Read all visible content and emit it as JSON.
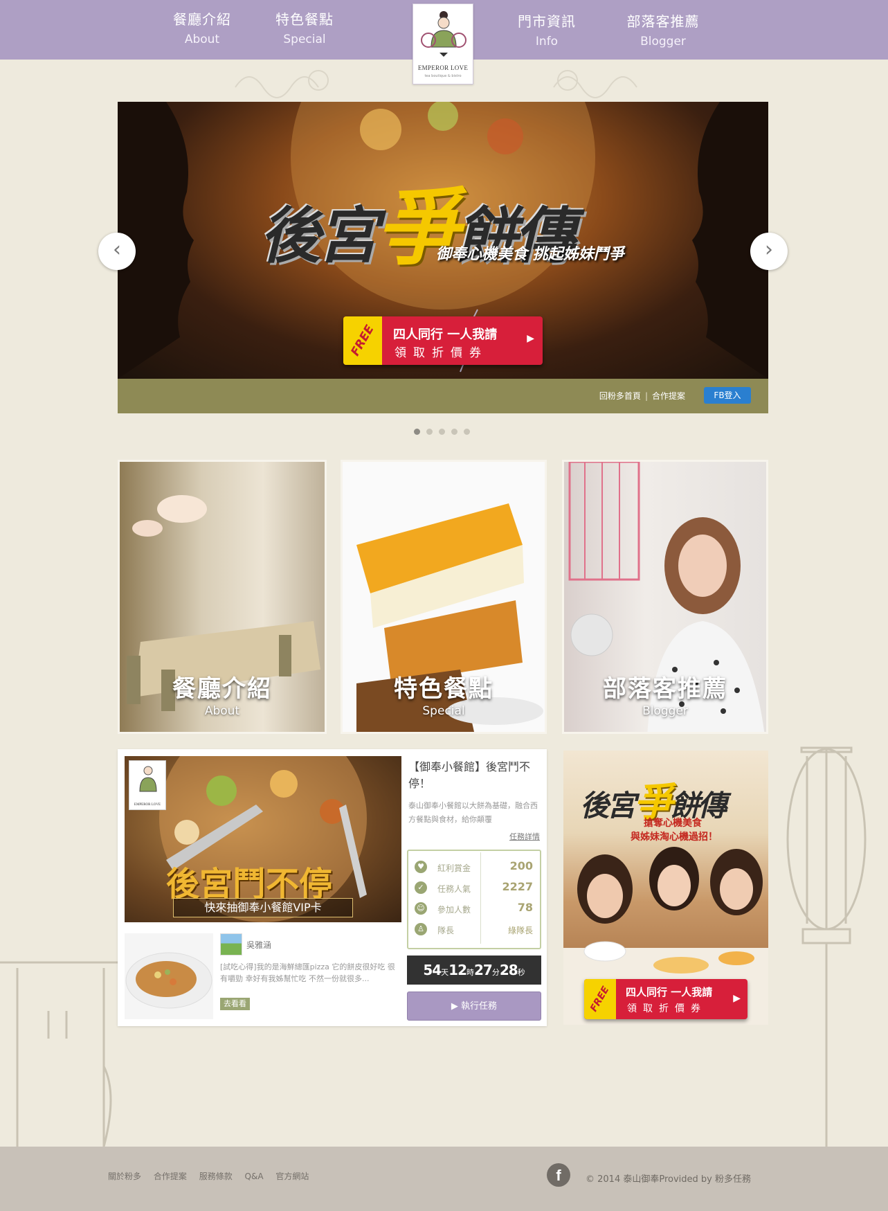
{
  "nav": {
    "about": {
      "zh": "餐廳介紹",
      "en": "About"
    },
    "special": {
      "zh": "特色餐點",
      "en": "Special"
    },
    "info": {
      "zh": "門市資訊",
      "en": "Info"
    },
    "blogger": {
      "zh": "部落客推薦",
      "en": "Blogger"
    }
  },
  "logo": {
    "name": "EMPEROR LOVE",
    "tagline": "tea boutique & bistro"
  },
  "hero": {
    "title_a": "後宮",
    "title_accent": "爭",
    "title_b": "餅傳",
    "subtitle": "御奉心機美食 挑起姊妹鬥爭",
    "cta_free": "FREE",
    "cta_line1": "四人同行 一人我請",
    "cta_line2": "領取折價券",
    "links": [
      "回粉多首頁",
      "合作提案"
    ],
    "fb_login": "FB登入",
    "slides": 5,
    "active_slide": 1
  },
  "cards": [
    {
      "title": "餐廳介紹",
      "subtitle": "About"
    },
    {
      "title": "特色餐點",
      "subtitle": "Special"
    },
    {
      "title": "部落客推薦",
      "subtitle": "Blogger"
    }
  ],
  "mission": {
    "image_title": "後宮鬥不停",
    "image_subtitle": "快來抽御奉小餐館VIP卡",
    "image_logo": "EMPEROR LOVE",
    "title": "【御奉小餐館】後宮鬥不停！",
    "description": "泰山御奉小餐館以大餅為基礎，融合西方餐點與食材，給你顛覆",
    "detail_link": "任務詳情",
    "stats": [
      {
        "icon": "heart-icon",
        "label": "紅利賞金",
        "value": "200"
      },
      {
        "icon": "thumbs-up-icon",
        "label": "任務人氣",
        "value": "2227"
      },
      {
        "icon": "smiley-icon",
        "label": "參加人數",
        "value": "78"
      },
      {
        "icon": "person-icon",
        "label": "隊長",
        "value": "綠隊長"
      }
    ],
    "countdown": {
      "days": "54",
      "days_unit": "天",
      "hours": "12",
      "hours_unit": "時",
      "minutes": "27",
      "minutes_unit": "分",
      "seconds": "28",
      "seconds_unit": "秒"
    },
    "exec_button": "▶ 執行任務",
    "review": {
      "name": "吳雅涵",
      "text": "[試吃心得]我的是海鮮總匯pizza  它的餅皮很好吃 很有嚼勁 幸好有我姊幫忙吃 不然一份就很多...",
      "button": "去看看"
    }
  },
  "promo": {
    "title_a": "後宮",
    "title_accent": "爭",
    "title_b": "餅傳",
    "line1": "搶奪心機美食",
    "line2": "與姊妹淘心機過招！",
    "cta_free": "FREE",
    "cta_line1": "四人同行 一人我請",
    "cta_line2": "領取折價券"
  },
  "footer": {
    "links": [
      "關於粉多",
      "合作提案",
      "服務條款",
      "Q&A",
      "官方網站"
    ],
    "copyright": "© 2014 泰山御奉Provided by 粉多任務"
  }
}
